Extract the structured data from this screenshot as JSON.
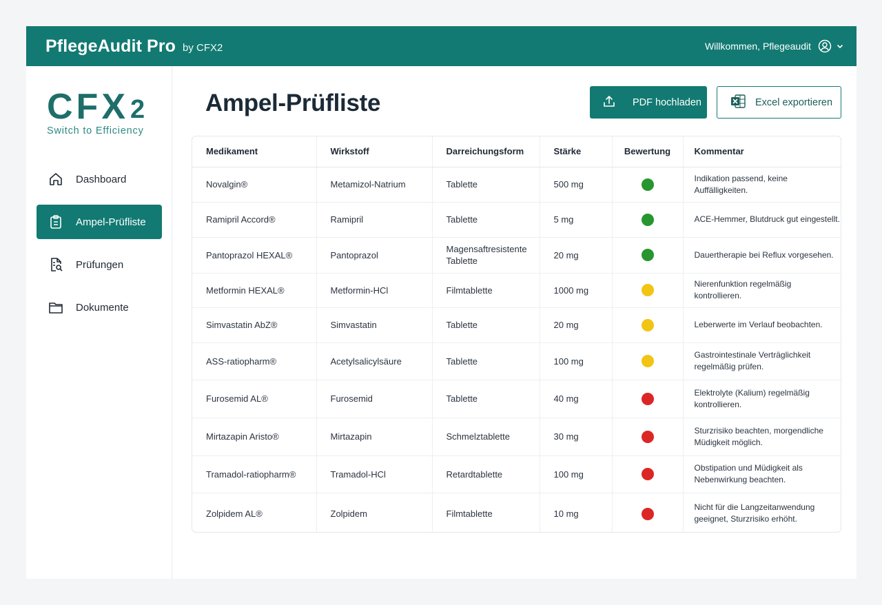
{
  "header": {
    "app_name": "PflegeAudit Pro",
    "by": "by CFX2",
    "welcome": "Willkommen, Pflegeaudit",
    "color": "#127a72"
  },
  "logo": {
    "main": "CFX",
    "sub": "2",
    "tagline": "Switch to Efficiency"
  },
  "sidebar": {
    "items": [
      {
        "label": "Dashboard",
        "icon": "home-icon",
        "active": false
      },
      {
        "label": "Ampel-Prüfliste",
        "icon": "clipboard-icon",
        "active": true
      },
      {
        "label": "Prüfungen",
        "icon": "document-search-icon",
        "active": false
      },
      {
        "label": "Dokumente",
        "icon": "folder-icon",
        "active": false
      }
    ]
  },
  "main": {
    "title": "Ampel-Prüfliste",
    "upload_label": "PDF hochladen",
    "export_label": "Excel exportieren"
  },
  "table": {
    "headers": [
      "Medikament",
      "Wirkstoff",
      "Darreichungsform",
      "Stärke",
      "Bewertung",
      "Kommentar"
    ],
    "status_colors": {
      "green": "#27962f",
      "yellow": "#f2c413",
      "red": "#dc2626"
    },
    "rows": [
      {
        "medikament": "Novalgin®",
        "wirkstoff": "Metamizol-Natrium",
        "form": "Tablette",
        "staerke": "500 mg",
        "bewertung": "green",
        "kommentar": "Indikation passend, keine Auffälligkeiten."
      },
      {
        "medikament": "Ramipril Accord®",
        "wirkstoff": "Ramipril",
        "form": "Tablette",
        "staerke": "5 mg",
        "bewertung": "green",
        "kommentar": "ACE-Hemmer, Blutdruck gut eingestellt."
      },
      {
        "medikament": "Pantoprazol HEXAL®",
        "wirkstoff": "Pantoprazol",
        "form": "Magensaftresistente Tablette",
        "staerke": "20 mg",
        "bewertung": "green",
        "kommentar": "Dauertherapie bei Reflux vorgesehen."
      },
      {
        "medikament": "Metformin HEXAL®",
        "wirkstoff": "Metformin-HCl",
        "form": "Filmtablette",
        "staerke": "1000 mg",
        "bewertung": "yellow",
        "kommentar": "Nierenfunktion regelmäßig kontrollieren."
      },
      {
        "medikament": "Simvastatin AbZ®",
        "wirkstoff": "Simvastatin",
        "form": "Tablette",
        "staerke": "20 mg",
        "bewertung": "yellow",
        "kommentar": "Leberwerte im Verlauf beobachten."
      },
      {
        "medikament": "ASS-ratiopharm®",
        "wirkstoff": "Acetylsalicylsäure",
        "form": "Tablette",
        "staerke": "100 mg",
        "bewertung": "yellow",
        "kommentar": "Gastrointestinale Verträglichkeit regelmäßig prüfen."
      },
      {
        "medikament": "Furosemid AL®",
        "wirkstoff": "Furosemid",
        "form": "Tablette",
        "staerke": "40 mg",
        "bewertung": "red",
        "kommentar": "Elektrolyte (Kalium) regelmäßig kontrollieren."
      },
      {
        "medikament": "Mirtazapin Aristo®",
        "wirkstoff": "Mirtazapin",
        "form": "Schmelztablette",
        "staerke": "30 mg",
        "bewertung": "red",
        "kommentar": "Sturzrisiko beachten, morgendliche Müdigkeit möglich."
      },
      {
        "medikament": "Tramadol-ratiopharm®",
        "wirkstoff": "Tramadol-HCl",
        "form": "Retardtablette",
        "staerke": "100 mg",
        "bewertung": "red",
        "kommentar": "Obstipation und Müdigkeit als Nebenwirkung beachten."
      },
      {
        "medikament": "Zolpidem AL®",
        "wirkstoff": "Zolpidem",
        "form": "Filmtablette",
        "staerke": "10 mg",
        "bewertung": "red",
        "kommentar": "Nicht für die Langzeitanwendung geeignet, Sturzrisiko erhöht."
      }
    ]
  }
}
